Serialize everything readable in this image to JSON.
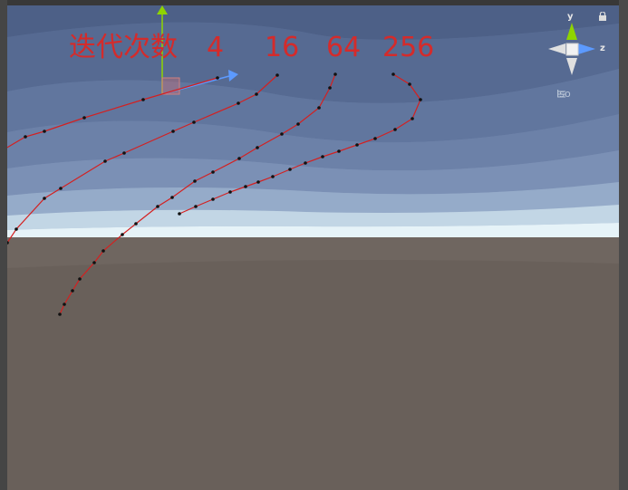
{
  "window": {
    "view_mode": "Iso",
    "gizmo_axis_y": "y",
    "gizmo_axis_z": "z"
  },
  "annotation": {
    "label": "迭代次数",
    "iterations": [
      "4",
      "16",
      "64",
      "256"
    ]
  },
  "colors": {
    "curve": "#d42020",
    "ground": "#69605a",
    "sky_top": "#5a6e93",
    "horizon": "#e6f3f8",
    "gizmo_y": "#8fd400",
    "gizmo_x": "#5c9aff"
  },
  "icons": [
    "lock-icon",
    "axis-gizmo-icon",
    "menu-icon",
    "transform-move-gizmo-icon"
  ]
}
